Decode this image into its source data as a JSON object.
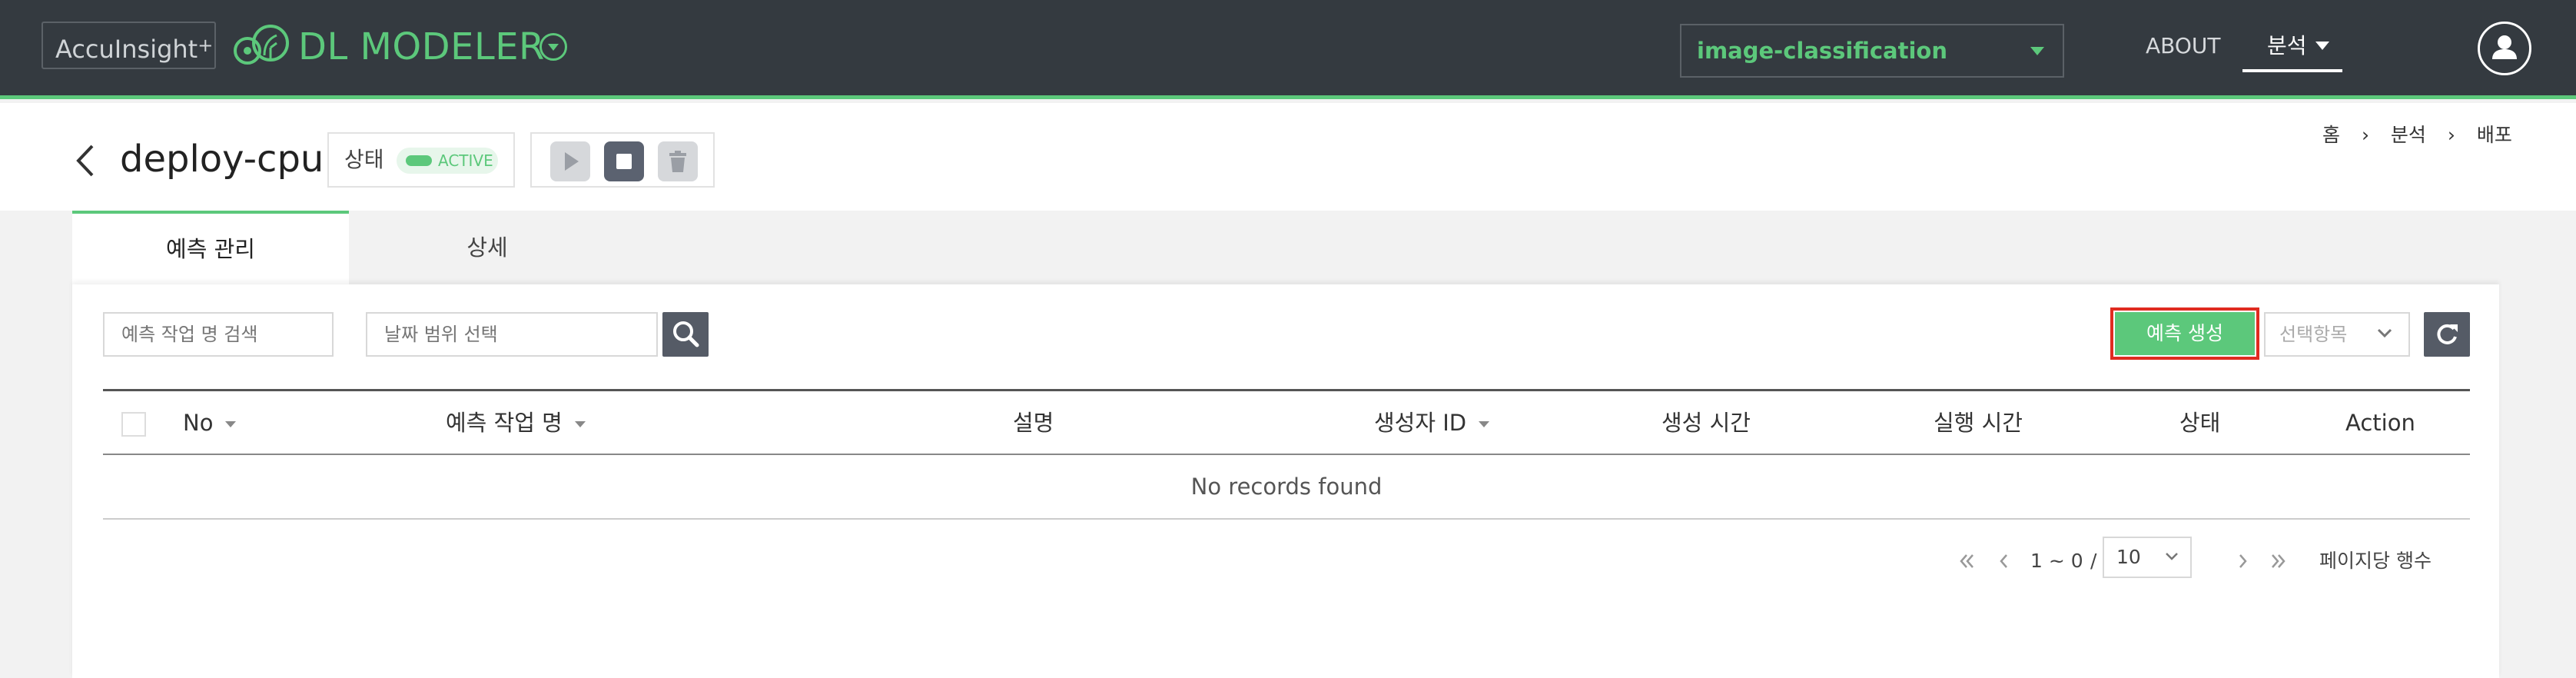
{
  "topbar": {
    "brand": "AccuInsight",
    "brand_sup": "+",
    "app_title": "DL MODELER",
    "project_select": "image-classification",
    "nav": {
      "about": "ABOUT",
      "analysis": "분석"
    }
  },
  "header": {
    "title": "deploy-cpu",
    "status_label": "상태",
    "status_value": "ACTIVE",
    "breadcrumb": [
      "홈",
      "분석",
      "배포"
    ]
  },
  "tabs": [
    {
      "label": "예측 관리",
      "active": true
    },
    {
      "label": "상세",
      "active": false
    }
  ],
  "toolbar": {
    "search_placeholder": "예측 작업 명 검색",
    "date_placeholder": "날짜 범위 선택",
    "create_label": "예측 생성",
    "column_select_placeholder": "선택항목"
  },
  "table": {
    "columns": [
      "No",
      "예측 작업 명",
      "설명",
      "생성자 ID",
      "생성 시간",
      "실행 시간",
      "상태",
      "Action"
    ],
    "empty_message": "No records found"
  },
  "pagination": {
    "range": "1 ~ 0",
    "separator": "/",
    "total": "0",
    "rows_label": "페이지당 행수",
    "rows_per_page": "10"
  },
  "colors": {
    "accent": "#5cc87b",
    "topbar": "#343a40",
    "highlight": "#e02b20"
  }
}
